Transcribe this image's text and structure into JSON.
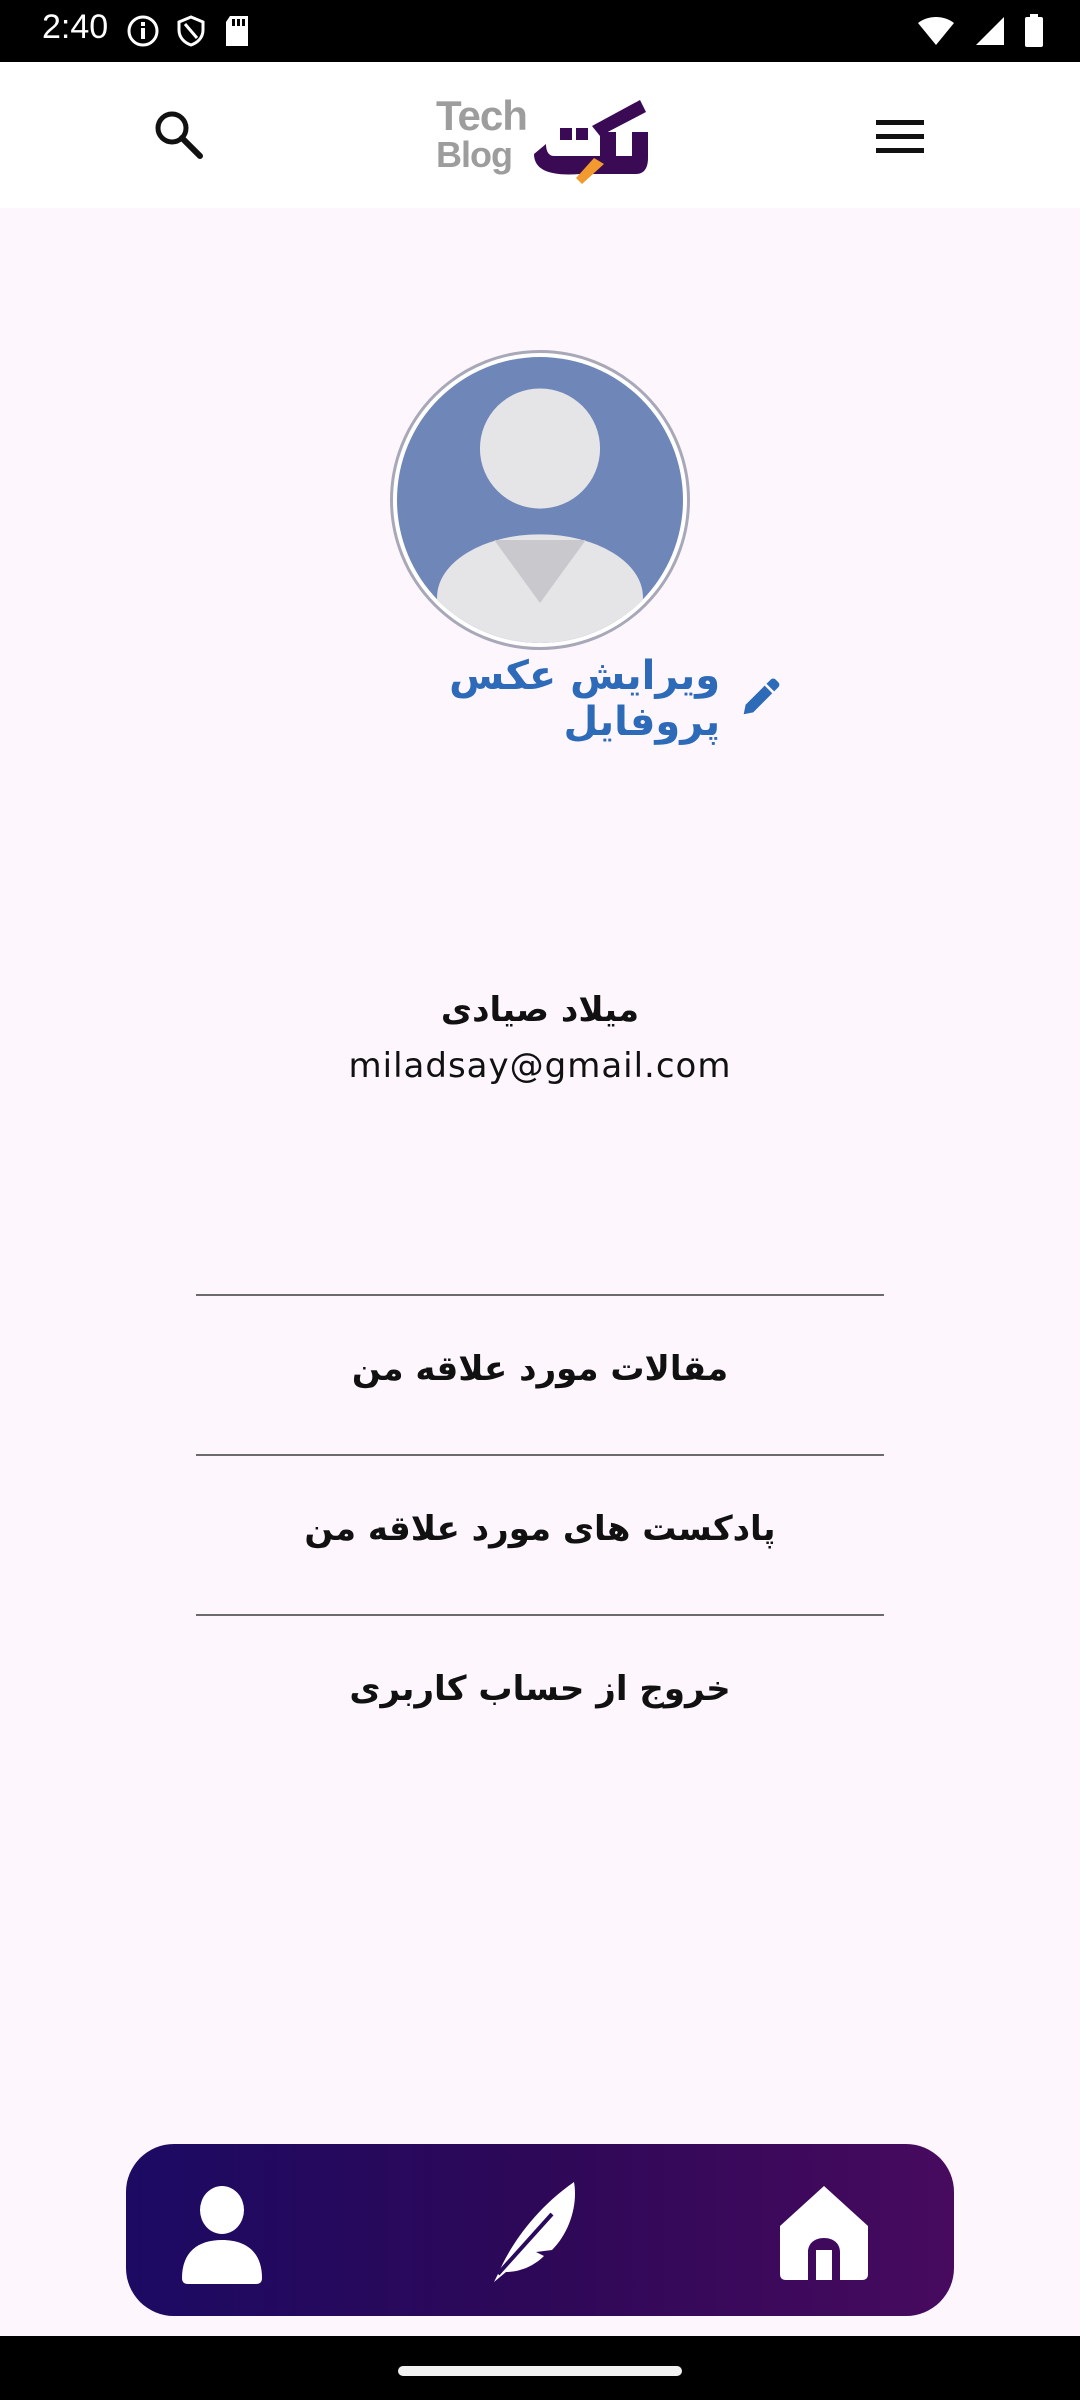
{
  "status_bar": {
    "time": "2:40",
    "left_icons": [
      "info-icon",
      "shield-icon",
      "sd-card-icon"
    ],
    "right_icons": [
      "wifi-icon",
      "signal-icon",
      "battery-icon"
    ]
  },
  "app_bar": {
    "logo_text_line1": "Tech",
    "logo_text_line2": "Blog",
    "logo_mark": "تک",
    "search_icon": "search-icon",
    "menu_icon": "menu-icon"
  },
  "profile": {
    "edit_photo_label": "ویرایش عکس پروفایل",
    "name": "میلاد صیادی",
    "email": "miladsay@gmail.com"
  },
  "menu": {
    "items": [
      {
        "label": "مقالات مورد علاقه من"
      },
      {
        "label": "پادکست های مورد علاقه من"
      },
      {
        "label": "خروج از حساب کاربری"
      }
    ]
  },
  "bottom_nav": {
    "items": [
      "profile-icon",
      "feather-pen-icon",
      "home-icon"
    ]
  },
  "colors": {
    "page_background": "#fdf6fd",
    "accent_blue": "#2d6ab8",
    "nav_gradient_start": "#1c0a63",
    "nav_gradient_end": "#470a5e",
    "logo_purple": "#3a0a55",
    "logo_orange": "#f29a2e"
  }
}
